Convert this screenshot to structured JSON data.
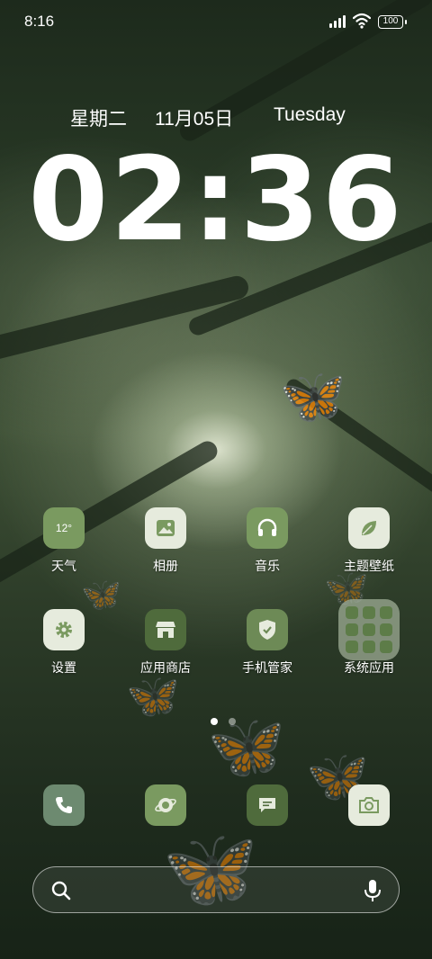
{
  "status_bar": {
    "time": "8:16",
    "battery": "100"
  },
  "clock_widget": {
    "weekday_cn": "星期二",
    "date_cn": "11月05日",
    "weekday_en": "Tuesday",
    "time": "02:36"
  },
  "apps_row1": [
    {
      "label": "天气",
      "icon": "weather-icon",
      "value": "12°"
    },
    {
      "label": "相册",
      "icon": "gallery-icon"
    },
    {
      "label": "音乐",
      "icon": "headphones-icon"
    },
    {
      "label": "主题壁纸",
      "icon": "leaf-icon"
    }
  ],
  "apps_row2": [
    {
      "label": "设置",
      "icon": "gear-icon"
    },
    {
      "label": "应用商店",
      "icon": "store-icon"
    },
    {
      "label": "手机管家",
      "icon": "shield-icon"
    },
    {
      "label": "系统应用",
      "icon": "folder-icon"
    }
  ],
  "page_indicator": {
    "current": 1,
    "total": 2
  },
  "dock": [
    {
      "icon": "phone-icon"
    },
    {
      "icon": "browser-icon"
    },
    {
      "icon": "message-icon"
    },
    {
      "icon": "camera-icon"
    }
  ],
  "search_bar": {
    "icon": "search-icon",
    "voice_icon": "microphone-icon"
  },
  "colors": {
    "icon_green": "#7a9a60",
    "icon_light": "#e6ebdd",
    "icon_dark": "#4f6b3c"
  }
}
